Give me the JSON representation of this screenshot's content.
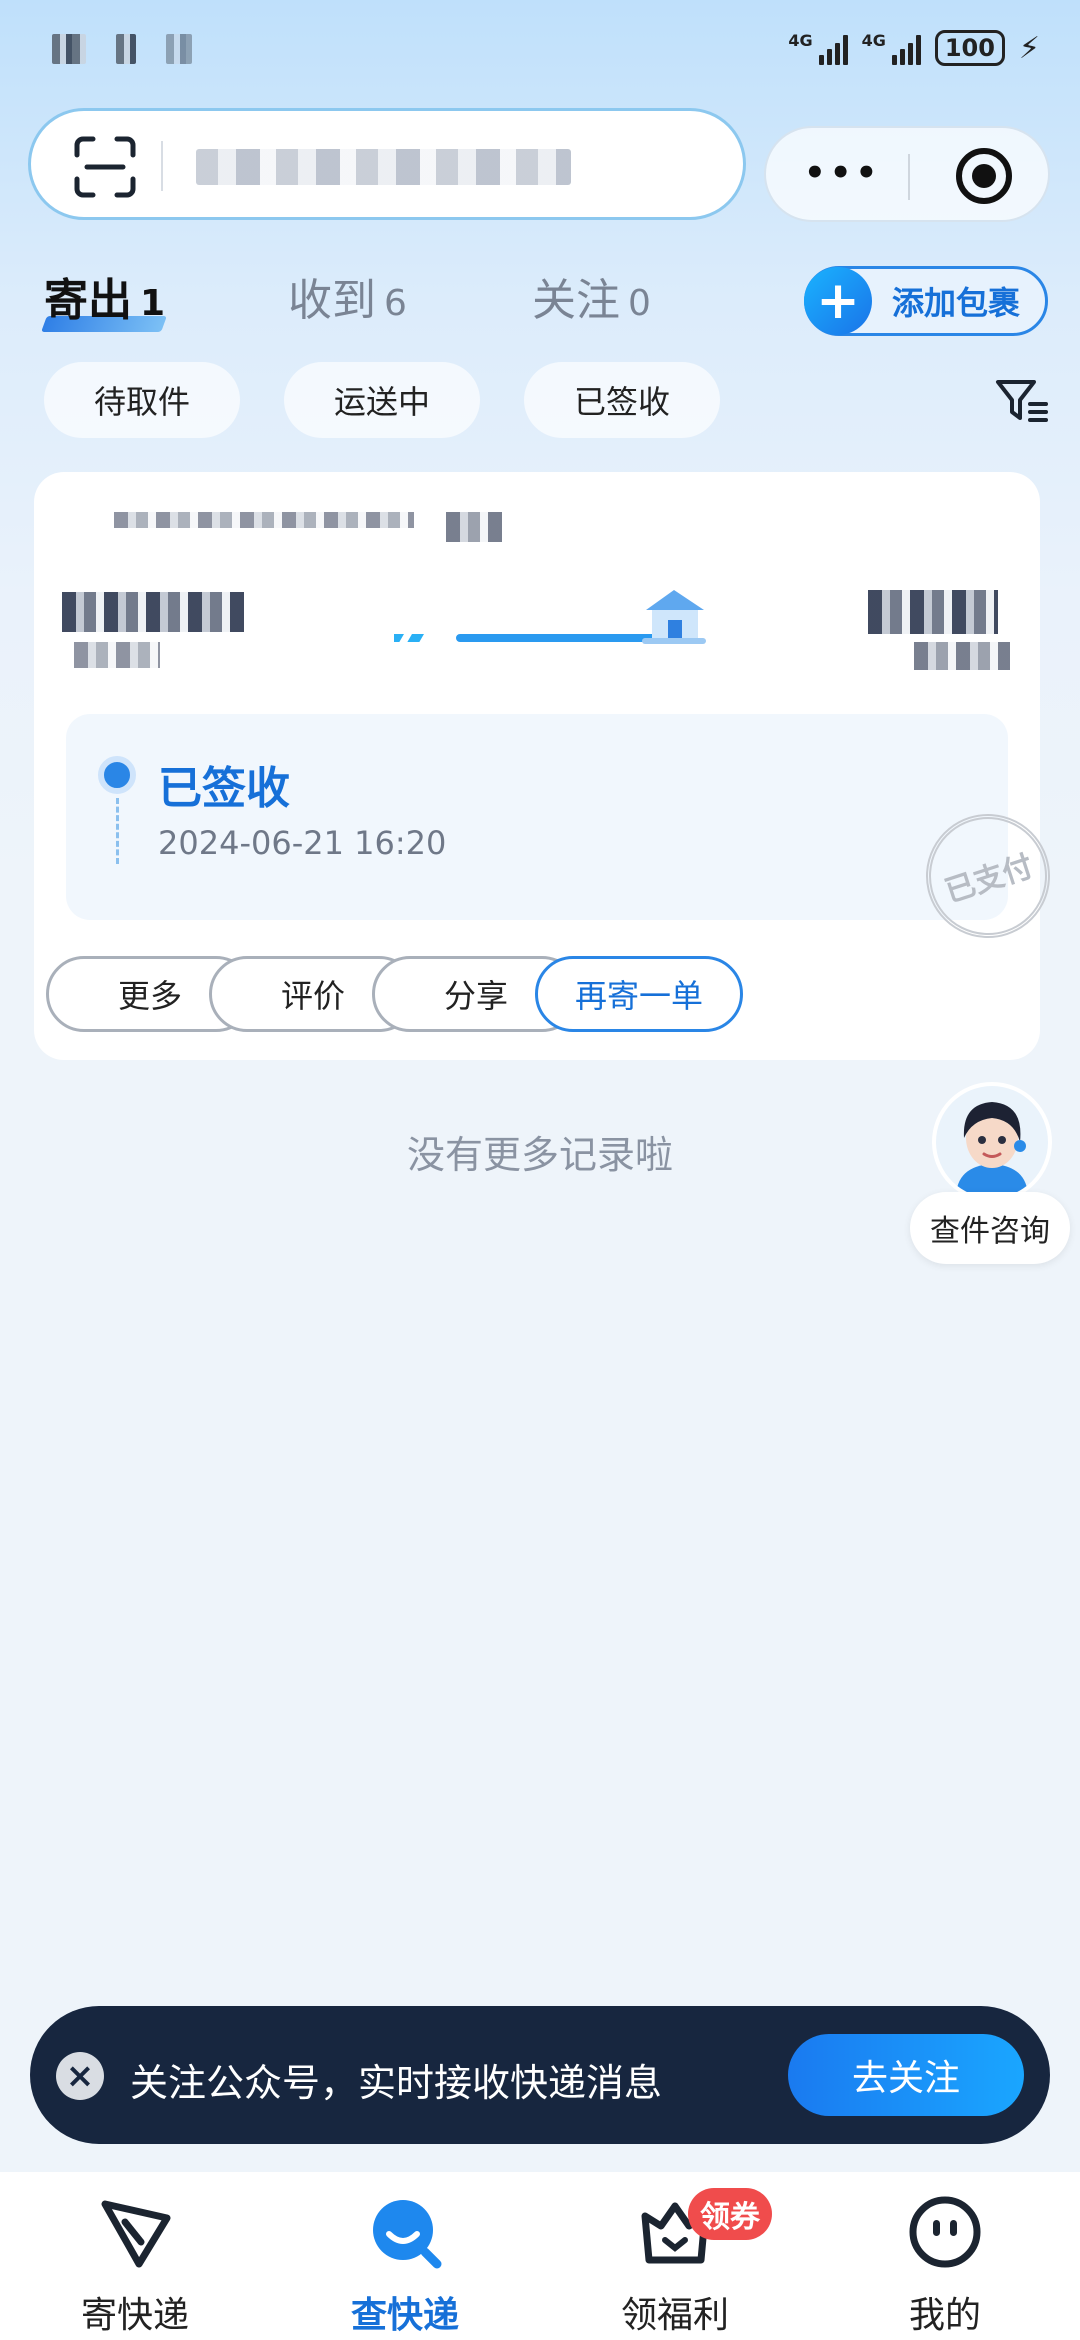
{
  "status_bar": {
    "network1": "4G",
    "network2": "4G",
    "battery": "100"
  },
  "tabs": [
    {
      "label": "寄出",
      "count": "1"
    },
    {
      "label": "收到",
      "count": "6"
    },
    {
      "label": "关注",
      "count": "0"
    }
  ],
  "add_package_label": "添加包裹",
  "filters": [
    "待取件",
    "运送中",
    "已签收"
  ],
  "card": {
    "status": "已签收",
    "time": "2024-06-21 16:20",
    "stamp": "已支付",
    "actions": [
      "更多",
      "评价",
      "分享",
      "再寄一单"
    ]
  },
  "no_more_text": "没有更多记录啦",
  "assistant_label": "查件咨询",
  "banner": {
    "text": "关注公众号，实时接收快递消息",
    "button": "去关注"
  },
  "bottom_nav": [
    {
      "label": "寄快递"
    },
    {
      "label": "查快递"
    },
    {
      "label": "领福利",
      "badge": "领券"
    },
    {
      "label": "我的"
    }
  ],
  "colors": {
    "accent": "#1670d8",
    "banner_bg": "#17263f",
    "badge": "#f04c4c"
  }
}
